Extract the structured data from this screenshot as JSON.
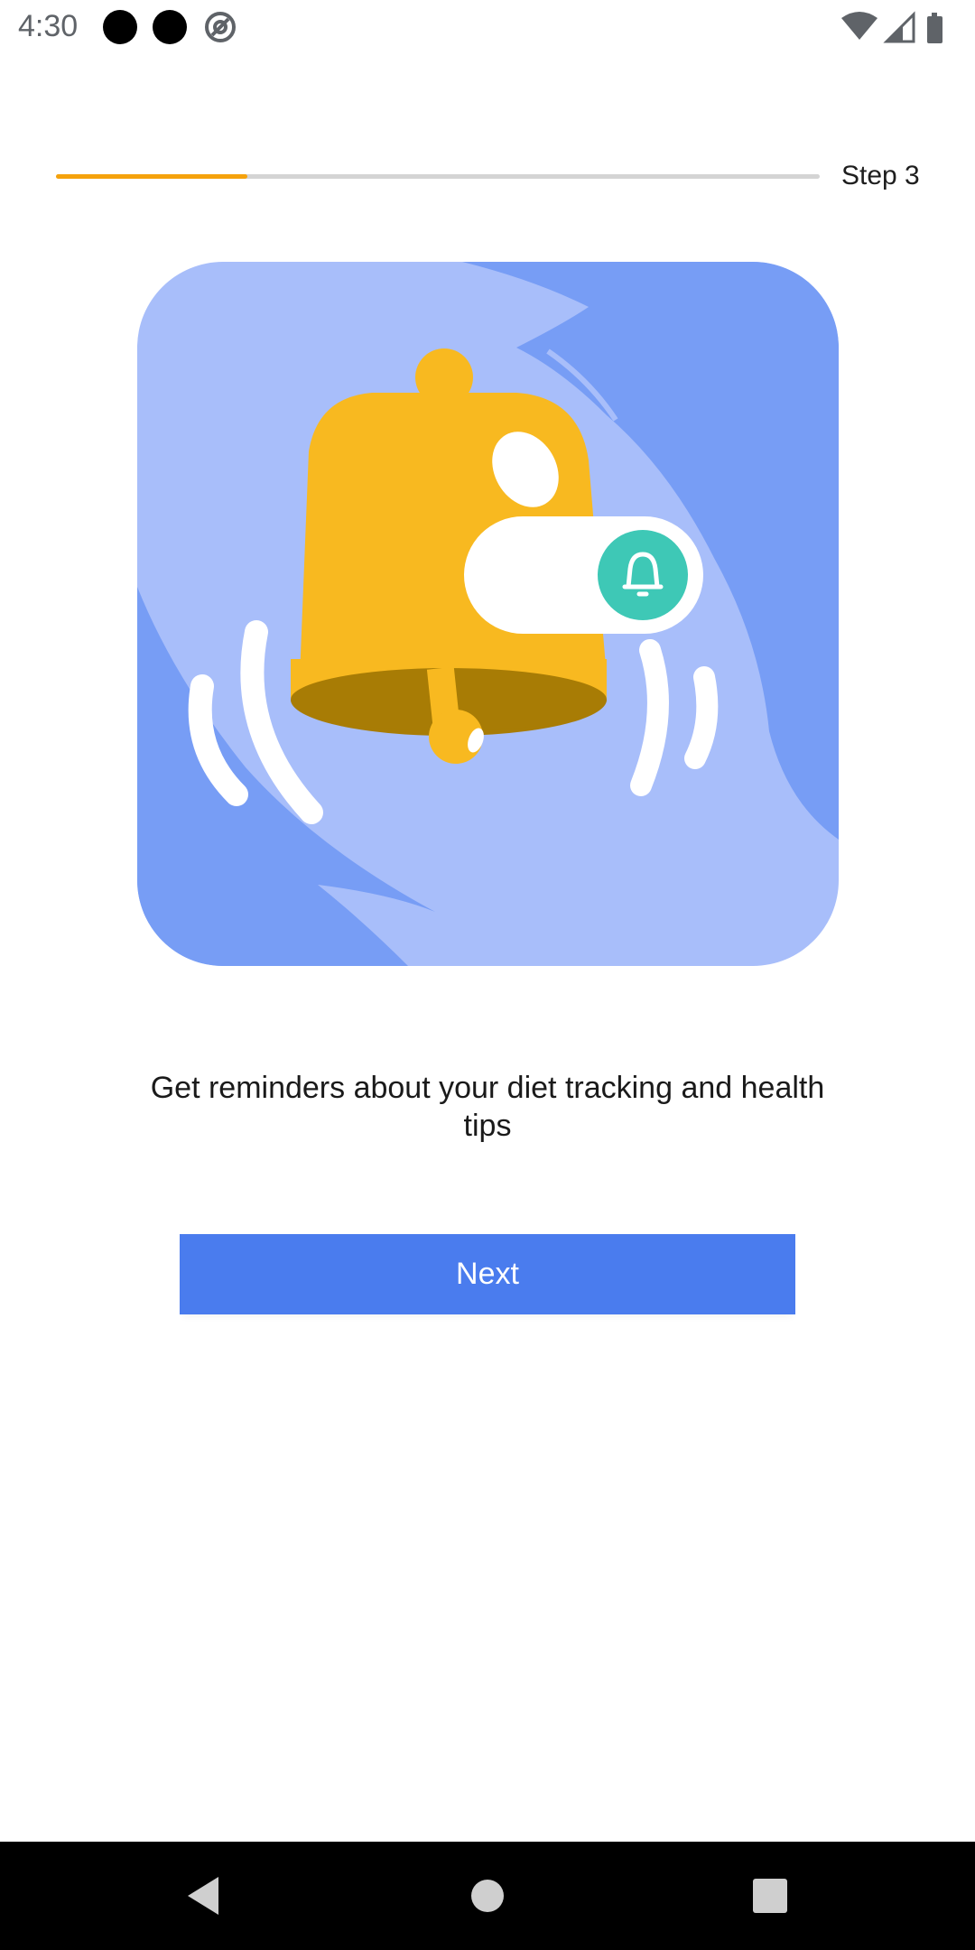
{
  "status_bar": {
    "time": "4:30",
    "icons": [
      "notification-dot-icon",
      "notification-dot-icon",
      "at-sign-icon",
      "wifi-icon",
      "cellular-signal-icon",
      "battery-icon"
    ]
  },
  "onboarding": {
    "progress_fraction": 0.25,
    "step_label": "Step 3",
    "illustration_icon": "bell-toggle-illustration",
    "description": "Get reminders about your diet tracking and health tips",
    "next_label": "Next"
  },
  "nav_bar": {
    "icons": [
      "back-icon",
      "home-icon",
      "recents-icon"
    ]
  },
  "colors": {
    "accent": "#f5a20c",
    "button": "#4a7cee",
    "illustration_bg": "#a8befa",
    "illustration_dark": "#779df5",
    "bell": "#f8b920",
    "bell_dark": "#a87c05",
    "toggle_knob": "#3ec8b6"
  }
}
